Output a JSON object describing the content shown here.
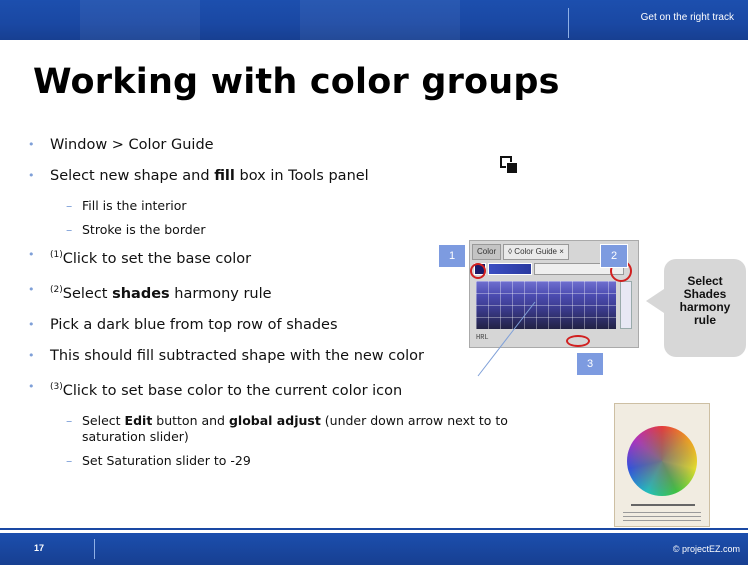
{
  "header": {
    "tagline": "Get on the right track"
  },
  "title": "Working with color groups",
  "bullets": {
    "b1": "Window > Color Guide",
    "b2_pre": "Select new shape and ",
    "b2_bold": "fill",
    "b2_post": " box in Tools panel",
    "b2_sub1": "Fill is the interior",
    "b2_sub2": "Stroke is the border",
    "b3_sup": "(1)",
    "b3": "Click to set the base color",
    "b4_sup": "(2)",
    "b4_pre": "Select ",
    "b4_bold": "shades",
    "b4_post": " harmony rule",
    "b5": "Pick a dark blue from top row of shades",
    "b6": "This should fill subtracted shape with the new color",
    "b7_sup": "(3)",
    "b7": "Click to set base color to the current color icon",
    "b7_sub1_pre": "Select ",
    "b7_sub1_bold1": "Edit",
    "b7_sub1_mid": " button and ",
    "b7_sub1_bold2": "global adjust",
    "b7_sub1_post": " (under down arrow next to to saturation slider)",
    "b7_sub2": "Set Saturation slider to -29"
  },
  "panel": {
    "tab_color": "Color",
    "tab_guide": "◊ Color Guide ×",
    "status": "HRL"
  },
  "callouts": {
    "n1": "1",
    "n2": "2",
    "n3": "3"
  },
  "side_callout": {
    "text": "Select Shades harmony rule"
  },
  "footer": {
    "page_number": "17",
    "copyright": "© projectEZ.com"
  },
  "colors": {
    "bar_blue": "#1a48a3",
    "bullet_blue": "#7fa0d8",
    "callout_blue": "#7d9be0",
    "highlight_red": "#d12020"
  },
  "icons": [
    "fill-stroke-icon",
    "color-wheel-icon"
  ]
}
